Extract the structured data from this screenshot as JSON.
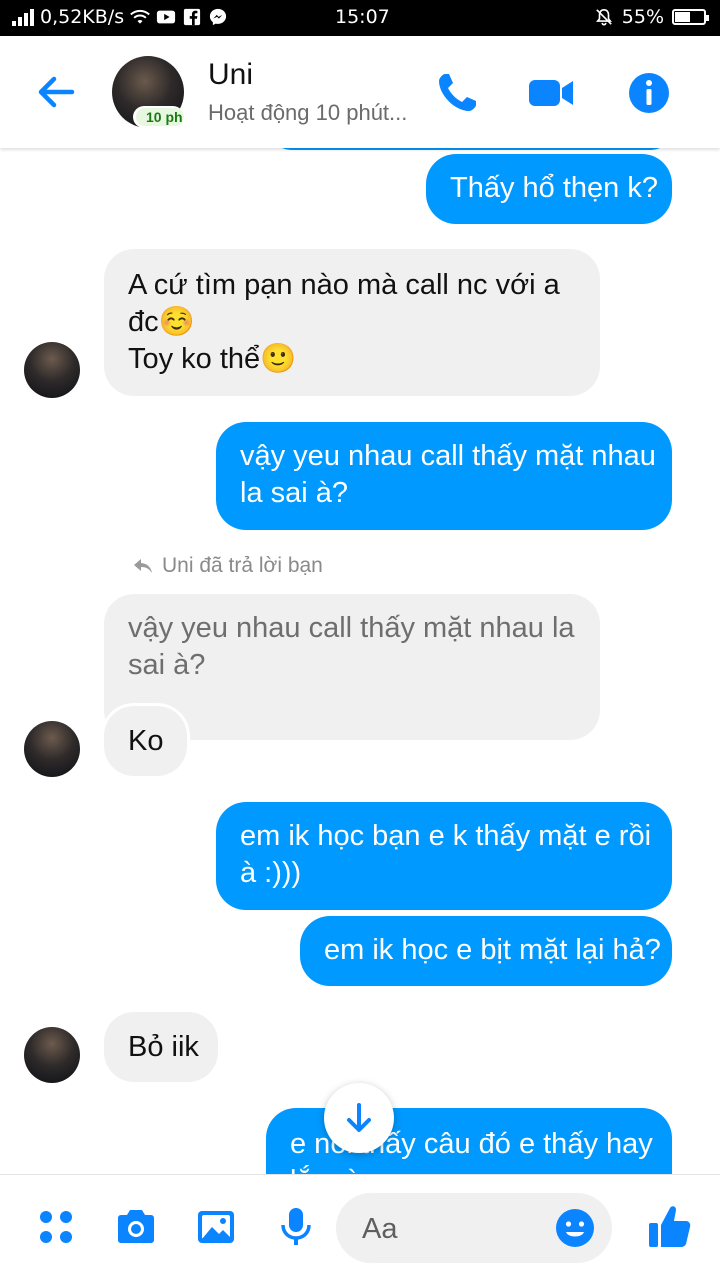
{
  "status_bar": {
    "network_speed": "0,52KB/s",
    "time": "15:07",
    "battery": "55%",
    "battery_level": 0.55,
    "icons": [
      "signal-icon",
      "wifi-icon",
      "youtube-icon",
      "facebook-icon",
      "messenger-icon",
      "mute-icon",
      "battery-icon"
    ]
  },
  "header": {
    "contact_name": "Uni",
    "status": "Hoạt động 10 phút...",
    "active_badge": "10 ph",
    "icons": [
      "back-arrow-icon",
      "phone-icon",
      "video-camera-icon",
      "info-icon"
    ]
  },
  "messages": [
    {
      "from": "me",
      "text": "Thấy hổ thẹn k?"
    },
    {
      "from": "contact",
      "text": "A cứ tìm pạn nào mà call nc với a",
      "text2": "đc",
      "emoji1": "☺️",
      "text3": "Toy ko thể",
      "emoji2": "🙂"
    },
    {
      "from": "me",
      "text": "vậy yeu nhau call thấy mặt nhau",
      "text2": "la sai à?"
    },
    {
      "from": "contact",
      "reply_note": "Uni đã trả lời bạn",
      "quoted": "vậy yeu nhau call thấy mặt nhau la",
      "quoted2": "sai à?",
      "text": "Ko"
    },
    {
      "from": "me",
      "text": "em ik học bạn e k thấy mặt e rồi",
      "text2": "à :)))"
    },
    {
      "from": "me",
      "text": "em ik học e bịt mặt lại hả?"
    },
    {
      "from": "contact",
      "text": "Bỏ iik"
    },
    {
      "from": "me",
      "text": "e nói thấy câu đó e thấy hay",
      "text2": "lắm à"
    }
  ],
  "composer": {
    "placeholder": "Aa",
    "icons": [
      "apps-grid-icon",
      "camera-icon",
      "gallery-icon",
      "microphone-icon",
      "emoji-icon",
      "thumbs-up-icon"
    ]
  },
  "colors": {
    "accent": "#0099ff",
    "incoming_bubble": "#f0f0f0",
    "status_bar": "#000000"
  }
}
